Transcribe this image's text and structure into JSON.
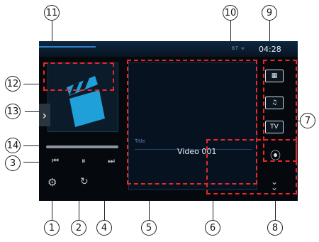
{
  "status": {
    "clock": "04:28",
    "indicator_text": "BT ᯤ"
  },
  "video": {
    "title_label": "Title",
    "name": "Video 001"
  },
  "sidebar": {
    "tv_label": "TV"
  },
  "callouts": [
    "1",
    "2",
    "3",
    "4",
    "5",
    "6",
    "7",
    "8",
    "9",
    "10",
    "11",
    "12",
    "13",
    "14"
  ],
  "colors": {
    "highlight": "#e8282a",
    "accent": "#2c7fc4",
    "thumbnail_icon": "#1fa0d8"
  }
}
